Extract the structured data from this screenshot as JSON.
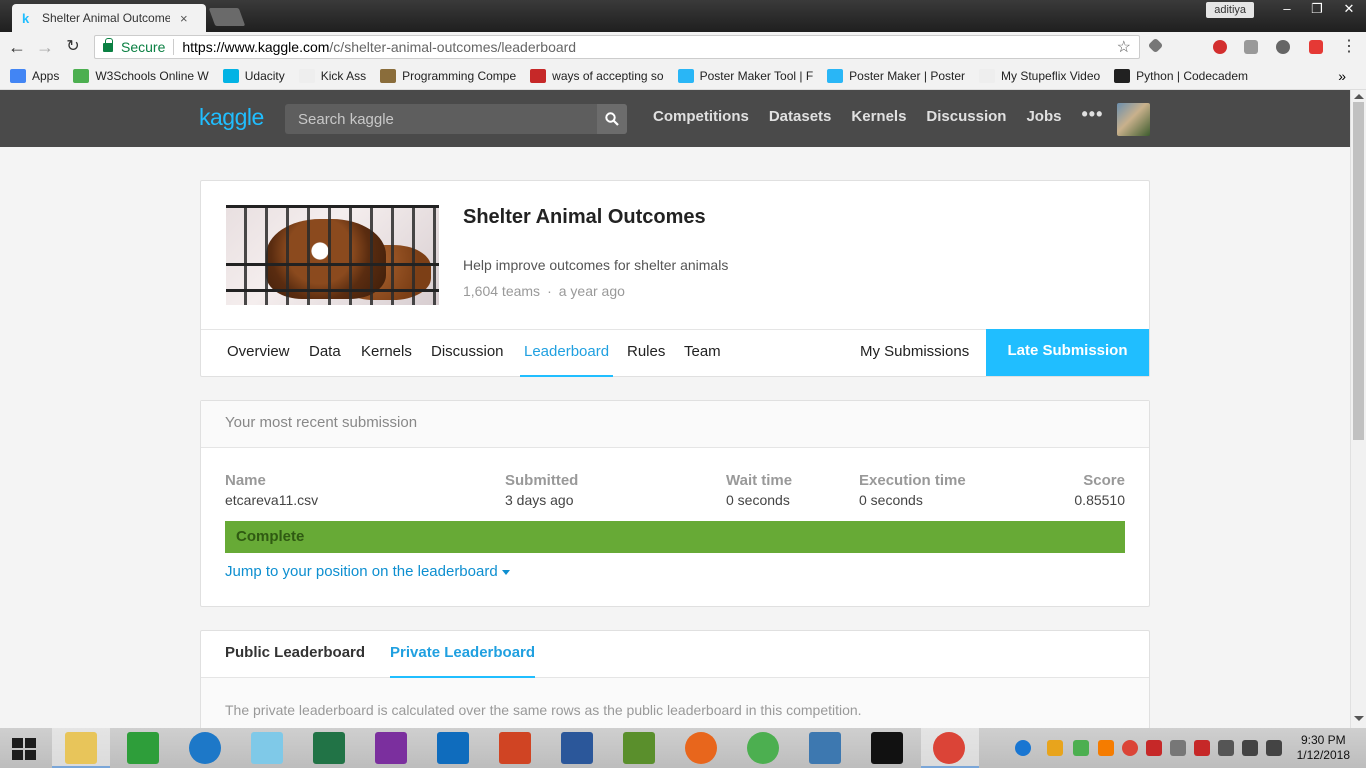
{
  "browser": {
    "tab_title": "Shelter Animal Outcome",
    "tab_close": "×",
    "user": "aditiya",
    "secure_label": "Secure",
    "url_host": "https://www.kaggle.com",
    "url_path": "/c/shelter-animal-outcomes/leaderboard",
    "bookmarks": [
      {
        "label": "Apps",
        "color": "#4285f4"
      },
      {
        "label": "W3Schools Online W",
        "color": "#4caf50"
      },
      {
        "label": "Udacity",
        "color": "#02b3e4"
      },
      {
        "label": "Kick Ass",
        "color": "#eeeeee"
      },
      {
        "label": "Programming Compe",
        "color": "#8a6d3b"
      },
      {
        "label": "ways of accepting so",
        "color": "#c62828"
      },
      {
        "label": "Poster Maker Tool | F",
        "color": "#29b6f6"
      },
      {
        "label": "Poster Maker | Poster",
        "color": "#29b6f6"
      },
      {
        "label": "My Stupeflix Video",
        "color": "#eeeeee"
      },
      {
        "label": "Python | Codecadem",
        "color": "#212121"
      }
    ],
    "bookmarks_more": "»"
  },
  "kaggle": {
    "logo": "kaggle",
    "search_placeholder": "Search kaggle",
    "nav": [
      "Competitions",
      "Datasets",
      "Kernels",
      "Discussion",
      "Jobs"
    ],
    "nav_more": "•••"
  },
  "competition": {
    "title": "Shelter Animal Outcomes",
    "subtitle": "Help improve outcomes for shelter animals",
    "teams": "1,604 teams",
    "dot": "·",
    "age": "a year ago",
    "tabs": [
      "Overview",
      "Data",
      "Kernels",
      "Discussion",
      "Leaderboard",
      "Rules",
      "Team"
    ],
    "active_tab": "Leaderboard",
    "my_submissions": "My Submissions",
    "late_submission": "Late Submission"
  },
  "submission": {
    "header": "Your most recent submission",
    "columns": [
      {
        "label": "Name",
        "value": "etcareva11.csv"
      },
      {
        "label": "Submitted",
        "value": "3 days ago"
      },
      {
        "label": "Wait time",
        "value": "0 seconds"
      },
      {
        "label": "Execution time",
        "value": "0 seconds"
      },
      {
        "label": "Score",
        "value": "0.85510"
      }
    ],
    "status": "Complete",
    "jump_link": "Jump to your position on the leaderboard"
  },
  "leaderboard": {
    "tabs": [
      "Public Leaderboard",
      "Private Leaderboard"
    ],
    "active_tab": "Private Leaderboard",
    "note": "The private leaderboard is calculated over the same rows as the public leaderboard in this competition."
  },
  "taskbar": {
    "time": "9:30 PM",
    "date": "1/12/2018"
  },
  "colors": {
    "kaggle_blue": "#20beff",
    "complete_green": "#67aa36",
    "header_dark": "#4a4a4a"
  }
}
